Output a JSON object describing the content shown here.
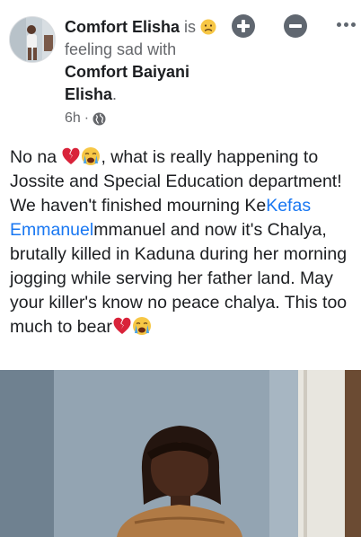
{
  "post": {
    "author": "Comfort Elisha",
    "feeling_prefix": "is",
    "feeling_emoji": "sad-face-icon",
    "feeling": "feeling sad",
    "with_prefix": "with",
    "tagged": "Comfort Baiyani Elisha",
    "tagged_suffix": ".",
    "time": "6h",
    "meta_separator": "·",
    "privacy_icon": "globe-icon"
  },
  "actions": {
    "add_icon": "plus-circle-icon",
    "remove_icon": "minus-circle-icon",
    "more_icon": "more-dots-icon"
  },
  "body": {
    "part1": "No na ",
    "emoji1": "broken-heart-icon",
    "emoji2": "crying-face-icon",
    "part2": ", what is really happening to Jossite and Special Education department! We haven't finished mourning Ke",
    "mention": "Kefas Emmanuel",
    "part3": "mmanuel and now it's Chalya, brutally killed in Kaduna during her morning jogging while serving her father land. May your killer's know no peace chalya. This too much to bear",
    "emoji3": "broken-heart-icon",
    "emoji4": "crying-face-icon"
  },
  "colors": {
    "link": "#1877f2",
    "muted": "#65676b",
    "icon": "#606770"
  }
}
